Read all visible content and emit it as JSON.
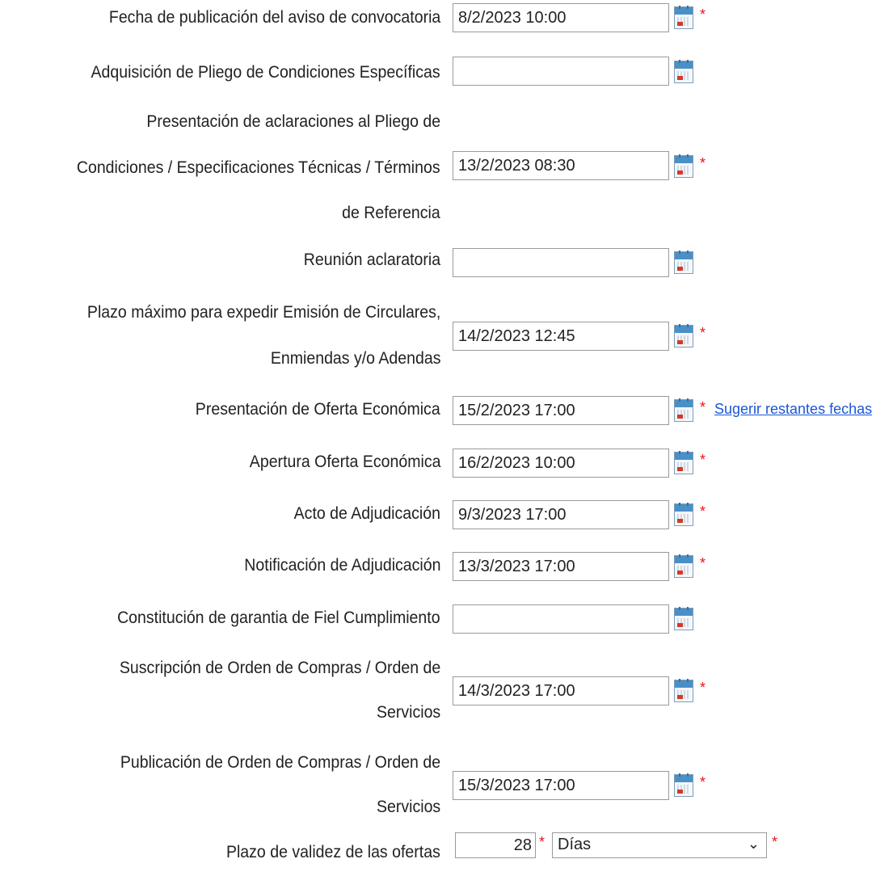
{
  "fields": [
    {
      "label": "Fecha de publicación del aviso de convocatoria",
      "value": "8/2/2023 10:00",
      "required": true
    },
    {
      "label": "Adquisición de Pliego de Condiciones Específicas",
      "value": "",
      "required": false
    },
    {
      "label_lines": [
        "Presentación de aclaraciones al Pliego de",
        "Condiciones / Especificaciones Técnicas / Términos",
        "de Referencia"
      ],
      "value": "13/2/2023 08:30",
      "required": true
    },
    {
      "label": "Reunión aclaratoria",
      "value": "",
      "required": false
    },
    {
      "label_lines": [
        "Plazo máximo para expedir Emisión de Circulares,",
        "Enmiendas y/o Adendas"
      ],
      "value": "14/2/2023 12:45",
      "required": true
    },
    {
      "label": "Presentación de Oferta Económica",
      "value": "15/2/2023 17:00",
      "required": true,
      "link": "Sugerir restantes fechas"
    },
    {
      "label": "Apertura Oferta Económica",
      "value": "16/2/2023 10:00",
      "required": true
    },
    {
      "label": "Acto de Adjudicación",
      "value": "9/3/2023 17:00",
      "required": true
    },
    {
      "label": "Notificación de Adjudicación",
      "value": "13/3/2023 17:00",
      "required": true
    },
    {
      "label": "Constitución de garantia de Fiel Cumplimiento",
      "value": "",
      "required": false
    },
    {
      "label_lines": [
        "Suscripción de Orden de Compras / Orden de",
        "Servicios"
      ],
      "value": "14/3/2023 17:00",
      "required": true
    },
    {
      "label_lines": [
        "Publicación de Orden de Compras / Orden de",
        "Servicios"
      ],
      "value": "15/3/2023 17:00",
      "required": true
    }
  ],
  "validity": {
    "label": "Plazo de validez de las ofertas",
    "number": "28",
    "unit": "Días"
  },
  "required_mark": "*",
  "colors": {
    "required": "#e8141a",
    "link": "#1a57d6",
    "input_border": "#9a9a9a"
  },
  "icons": {
    "calendar": "calendar-icon",
    "dropdown": "chevron-down-icon"
  }
}
